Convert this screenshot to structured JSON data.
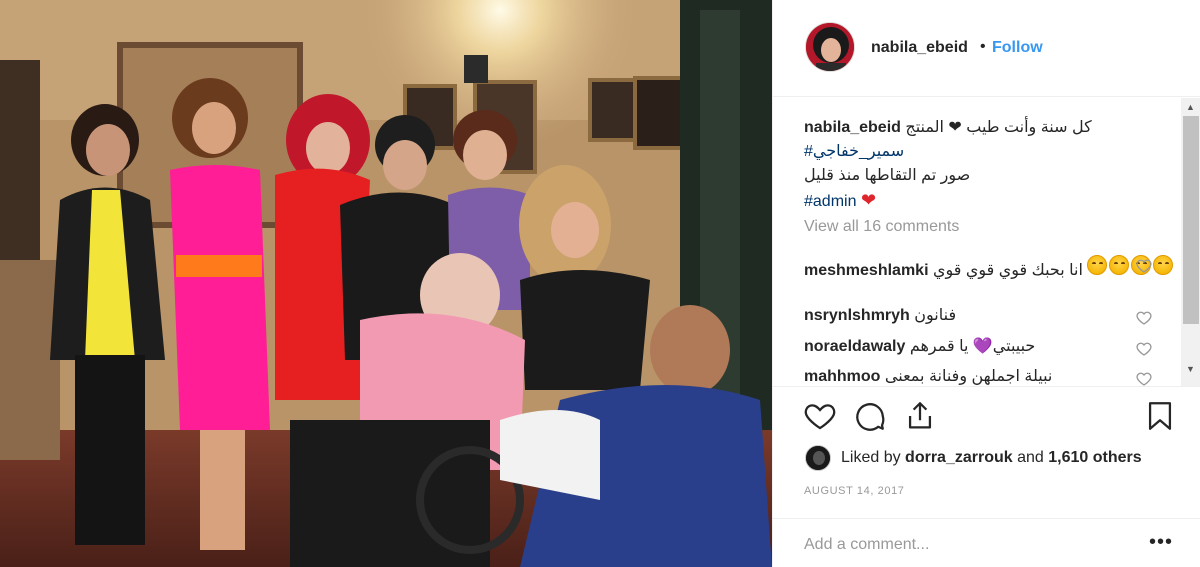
{
  "post": {
    "username": "nabila_ebeid",
    "separator": "•",
    "follow_label": "Follow"
  },
  "caption": {
    "username": "nabila_ebeid",
    "line1_text": "كل سنة وأنت طيب ❤ المنتج",
    "hashtag1": "#سمير_خفاجي",
    "line3_text": "صور تم التقاطها منذ قليل",
    "hashtag2": "#admin",
    "heart": "❤"
  },
  "view_all_comments": "View all 16 comments",
  "comments": [
    {
      "username": "meshmeshlamki",
      "text": "انا بحبك قوي قوي قوي"
    },
    {
      "username": "nsrynlshmryh",
      "text": "فنانون"
    },
    {
      "username": "noraeldawaly",
      "text": "حبيبتي💜 يا قمرهم"
    },
    {
      "username": "mahhmoo",
      "text": "نبيلة اجملهن وفنانة بمعنى"
    }
  ],
  "icons": {
    "like": "heart-outline-icon",
    "comment": "comment-bubble-icon",
    "share": "share-icon",
    "save": "bookmark-icon"
  },
  "likes": {
    "prefix": "Liked by",
    "user": "dorra_zarrouk",
    "suffix": "and",
    "count": "1,610 others"
  },
  "date": "AUGUST 14, 2017",
  "add_comment": {
    "placeholder": "Add a comment...",
    "more": "•••"
  },
  "colors": {
    "link": "#3897f0",
    "hashtag": "#003569",
    "heart": "#e0262d",
    "muted": "#999999"
  }
}
